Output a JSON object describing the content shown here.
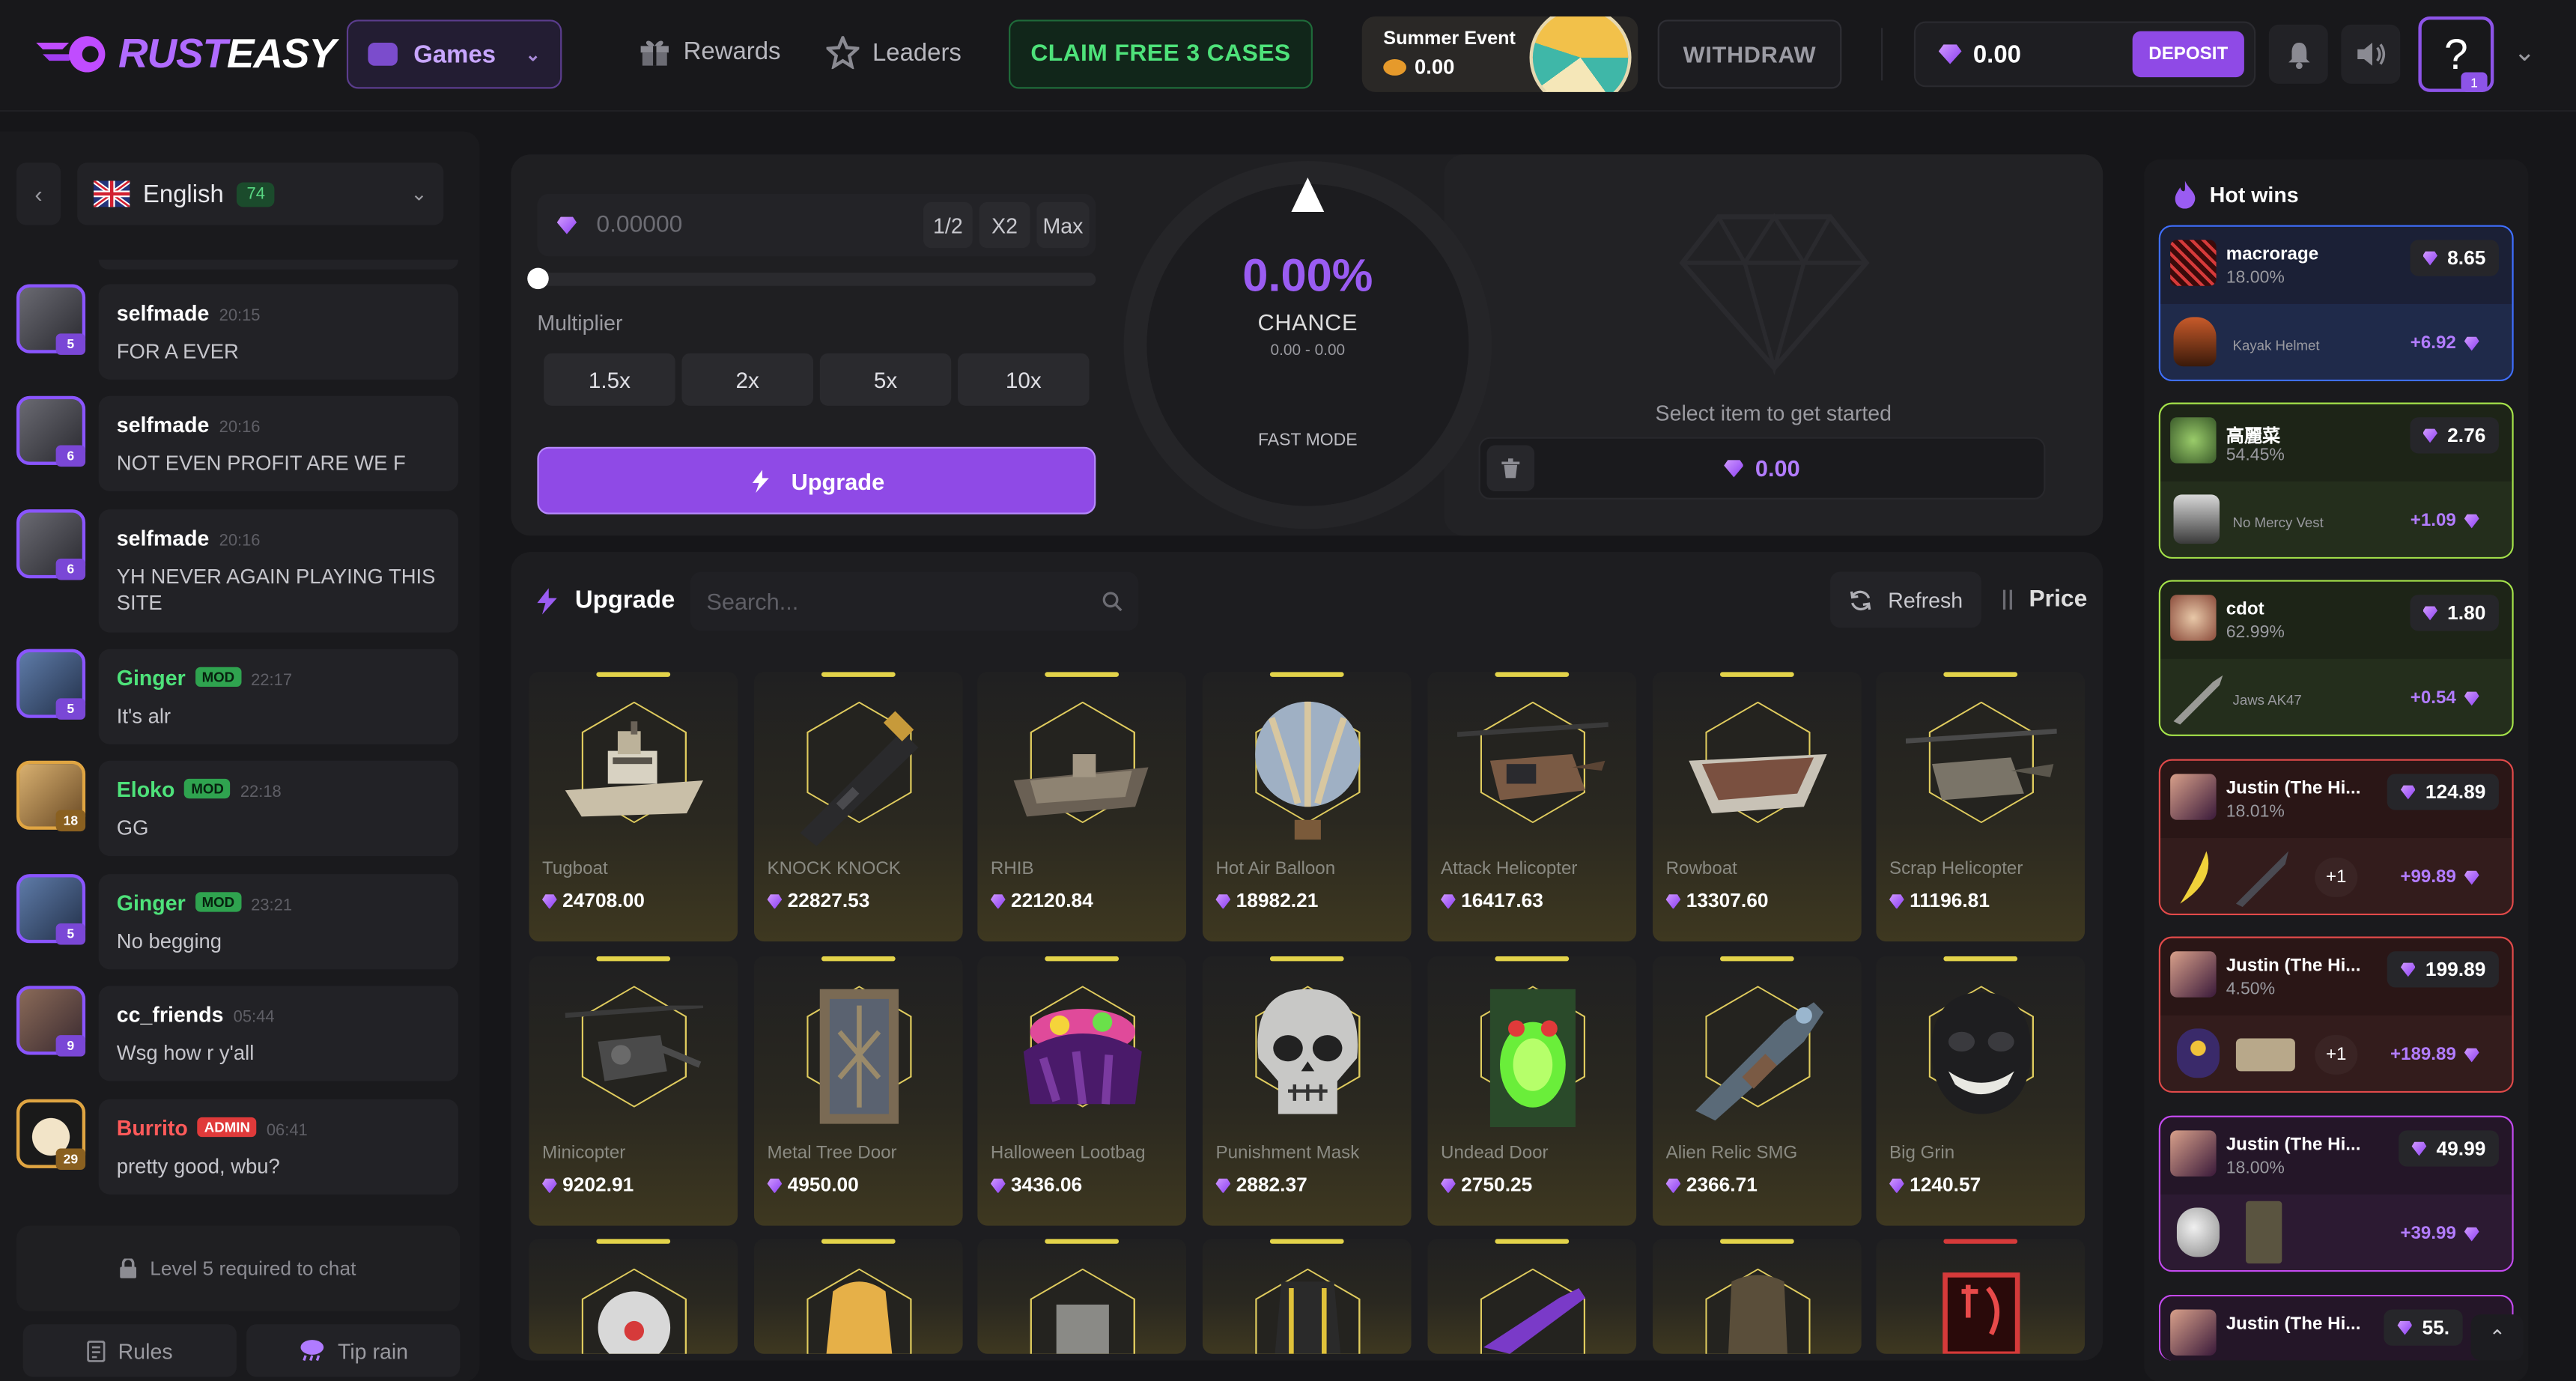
{
  "header": {
    "logo": {
      "part1": "RUST",
      "part2": "EASY"
    },
    "games_label": "Games",
    "rewards_label": "Rewards",
    "leaders_label": "Leaders",
    "claim_label": "CLAIM FREE 3 CASES",
    "summer": {
      "title": "Summer Event",
      "value": "0.00"
    },
    "withdraw_label": "WITHDRAW",
    "balance": "0.00",
    "deposit_label": "DEPOSIT",
    "help_label": "?",
    "help_badge": "1"
  },
  "chat": {
    "language": "English",
    "online_count": "74",
    "messages": [
      {
        "user": "selfmade",
        "time": "20:15",
        "text": "FOR A EVER",
        "level": "5",
        "tag": ""
      },
      {
        "user": "selfmade",
        "time": "20:16",
        "text": "NOT EVEN PROFIT ARE WE F",
        "level": "6",
        "tag": ""
      },
      {
        "user": "selfmade",
        "time": "20:16",
        "text": "YH NEVER AGAIN PLAYING THIS SITE",
        "level": "6",
        "tag": ""
      },
      {
        "user": "Ginger",
        "time": "22:17",
        "text": "It's alr",
        "level": "5",
        "tag": "MOD"
      },
      {
        "user": "Eloko",
        "time": "22:18",
        "text": "GG",
        "level": "18",
        "tag": "MOD"
      },
      {
        "user": "Ginger",
        "time": "23:21",
        "text": "No begging",
        "level": "5",
        "tag": "MOD"
      },
      {
        "user": "cc_friends",
        "time": "05:44",
        "text": "Wsg how r y'all",
        "level": "9",
        "tag": ""
      },
      {
        "user": "Burrito",
        "time": "06:41",
        "text": "pretty good, wbu?",
        "level": "29",
        "tag": "ADMIN"
      }
    ],
    "level_required": "Level 5 required to chat",
    "rules_label": "Rules",
    "tip_rain_label": "Tip rain"
  },
  "upgrade": {
    "amount_placeholder": "0.00000",
    "half_label": "1/2",
    "double_label": "X2",
    "max_label": "Max",
    "multiplier_label": "Multiplier",
    "multipliers": [
      "1.5x",
      "2x",
      "5x",
      "10x"
    ],
    "upgrade_button": "Upgrade",
    "chance_value": "0.00%",
    "chance_label": "CHANCE",
    "chance_range": "0.00 - 0.00",
    "fast_mode": "FAST MODE",
    "select_prompt": "Select item to get started",
    "selected_value": "0.00"
  },
  "items_section": {
    "title": "Upgrade",
    "search_placeholder": "Search...",
    "refresh_label": "Refresh",
    "price_label": "Price",
    "items": [
      {
        "name": "Tugboat",
        "price": "24708.00"
      },
      {
        "name": "KNOCK KNOCK",
        "price": "22827.53"
      },
      {
        "name": "RHIB",
        "price": "22120.84"
      },
      {
        "name": "Hot Air Balloon",
        "price": "18982.21"
      },
      {
        "name": "Attack Helicopter",
        "price": "16417.63"
      },
      {
        "name": "Rowboat",
        "price": "13307.60"
      },
      {
        "name": "Scrap Helicopter",
        "price": "11196.81"
      },
      {
        "name": "Minicopter",
        "price": "9202.91"
      },
      {
        "name": "Metal Tree Door",
        "price": "4950.00"
      },
      {
        "name": "Halloween Lootbag",
        "price": "3436.06"
      },
      {
        "name": "Punishment Mask",
        "price": "2882.37"
      },
      {
        "name": "Undead Door",
        "price": "2750.25"
      },
      {
        "name": "Alien Relic SMG",
        "price": "2366.71"
      },
      {
        "name": "Big Grin",
        "price": "1240.57"
      }
    ]
  },
  "hot_wins": {
    "title": "Hot wins",
    "wins": [
      {
        "user": "macrorage",
        "pct": "18.00%",
        "value": "8.65",
        "item": "Kayak Helmet",
        "profit": "+6.92",
        "accent": "#3f6fff"
      },
      {
        "user": "高麗菜",
        "pct": "54.45%",
        "value": "2.76",
        "item": "No Mercy Vest",
        "profit": "+1.09",
        "accent": "#a5e34a"
      },
      {
        "user": "cdot",
        "pct": "62.99%",
        "value": "1.80",
        "item": "Jaws AK47",
        "profit": "+0.54",
        "accent": "#a5e34a"
      },
      {
        "user": "Justin (The Hi...",
        "pct": "18.01%",
        "value": "124.89",
        "item": "",
        "extra": "+1",
        "profit": "+99.89",
        "accent": "#e24a4a"
      },
      {
        "user": "Justin (The Hi...",
        "pct": "4.50%",
        "value": "199.89",
        "item": "",
        "extra": "+1",
        "profit": "+189.89",
        "accent": "#e24a4a"
      },
      {
        "user": "Justin (The Hi...",
        "pct": "18.00%",
        "value": "49.99",
        "item": "",
        "extra": "",
        "profit": "+39.99",
        "accent": "#c44af0"
      },
      {
        "user": "Justin (The Hi...",
        "pct": "",
        "value": "55.",
        "item": "",
        "extra": "",
        "profit": "",
        "accent": "#c44af0"
      }
    ]
  }
}
